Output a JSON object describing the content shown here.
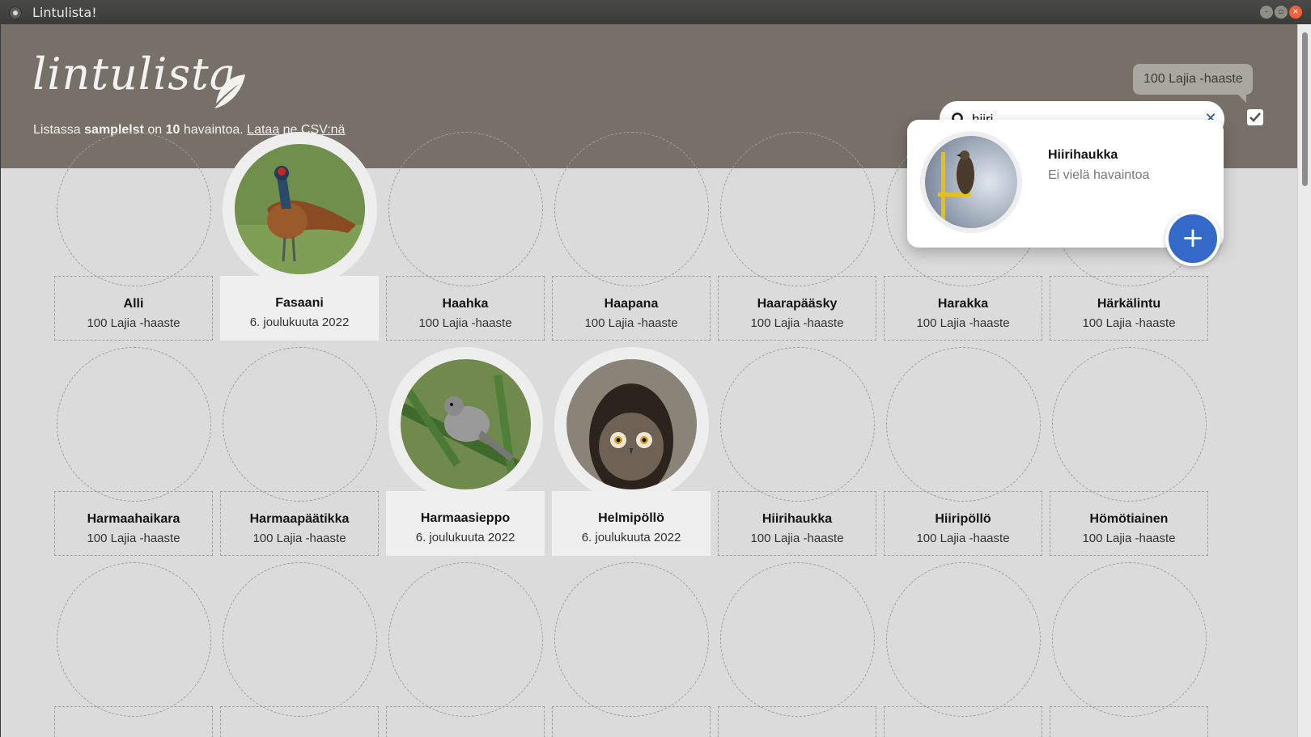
{
  "window": {
    "title": "Lintulista!"
  },
  "header": {
    "logo_text": "lintulista",
    "summary_prefix": "Listassa ",
    "list_name": "samplelst",
    "summary_middle": " on ",
    "count": "10",
    "summary_suffix": " havaintoa. ",
    "csv_link": "Lataa ne CSV:nä",
    "tooltip": "100 Lajia -haaste"
  },
  "search": {
    "value": "hiiri",
    "clear_symbol": "✕"
  },
  "popup": {
    "name": "Hiirihaukka",
    "status": "Ei vielä havaintoa",
    "add_symbol": "+"
  },
  "cards": [
    {
      "name": "Alli",
      "sub": "100 Lajia -haaste",
      "seen": false
    },
    {
      "name": "Fasaani",
      "sub": "6. joulukuuta 2022",
      "seen": true
    },
    {
      "name": "Haahka",
      "sub": "100 Lajia -haaste",
      "seen": false
    },
    {
      "name": "Haapana",
      "sub": "100 Lajia -haaste",
      "seen": false
    },
    {
      "name": "Haarapääsky",
      "sub": "100 Lajia -haaste",
      "seen": false
    },
    {
      "name": "Harakka",
      "sub": "100 Lajia -haaste",
      "seen": false
    },
    {
      "name": "Härkälintu",
      "sub": "100 Lajia -haaste",
      "seen": false
    },
    {
      "name": "Harmaahaikara",
      "sub": "100 Lajia -haaste",
      "seen": false
    },
    {
      "name": "Harmaapäätikka",
      "sub": "100 Lajia -haaste",
      "seen": false
    },
    {
      "name": "Harmaasieppo",
      "sub": "6. joulukuuta 2022",
      "seen": true
    },
    {
      "name": "Helmipöllö",
      "sub": "6. joulukuuta 2022",
      "seen": true
    },
    {
      "name": "Hiirihaukka",
      "sub": "100 Lajia -haaste",
      "seen": false
    },
    {
      "name": "Hiiripöllö",
      "sub": "100 Lajia -haaste",
      "seen": false
    },
    {
      "name": "Hömötiainen",
      "sub": "100 Lajia -haaste",
      "seen": false
    }
  ],
  "colors": {
    "header": "#767069",
    "background": "#dbdbdb",
    "accent": "#3569c9"
  }
}
